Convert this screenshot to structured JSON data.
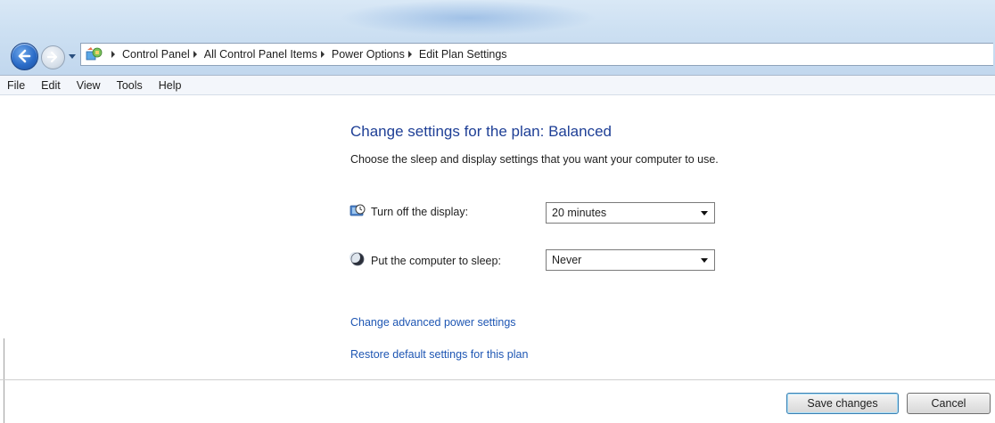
{
  "address_bar": {
    "breadcrumbs": [
      "Control Panel",
      "All Control Panel Items",
      "Power Options",
      "Edit Plan Settings"
    ]
  },
  "menu": {
    "items": [
      "File",
      "Edit",
      "View",
      "Tools",
      "Help"
    ]
  },
  "content": {
    "title": "Change settings for the plan: Balanced",
    "subtitle": "Choose the sleep and display settings that you want your computer to use.",
    "display_setting": {
      "label": "Turn off the display:",
      "value": "20 minutes",
      "icon": "display-timer-icon"
    },
    "sleep_setting": {
      "label": "Put the computer to sleep:",
      "value": "Never",
      "icon": "moon-icon"
    },
    "links": {
      "advanced": "Change advanced power settings",
      "restore": "Restore default settings for this plan"
    }
  },
  "footer": {
    "save_label": "Save changes",
    "cancel_label": "Cancel"
  },
  "colors": {
    "title": "#1e3f96",
    "link": "#1e56b3",
    "chrome": "#cde0f2"
  }
}
